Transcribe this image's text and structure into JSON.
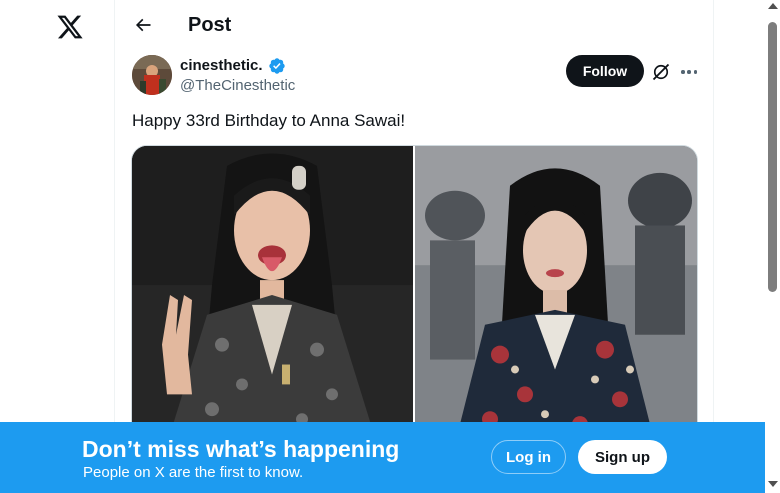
{
  "header": {
    "title": "Post"
  },
  "tweet": {
    "display_name": "cinesthetic.",
    "handle": "@TheCinesthetic",
    "text": "Happy 33rd Birthday to Anna Sawai!",
    "follow_label": "Follow"
  },
  "banner": {
    "title": "Don’t miss what’s happening",
    "subtitle": "People on X are the first to know.",
    "login_label": "Log in",
    "signup_label": "Sign up"
  },
  "colors": {
    "brand_blue": "#1d9bf0",
    "text_primary": "#0f1419",
    "text_secondary": "#536471",
    "verified": "#1d9bf0"
  },
  "icons": [
    "x-logo-icon",
    "back-arrow-icon",
    "verified-badge-icon",
    "grok-icon",
    "more-options-icon"
  ]
}
